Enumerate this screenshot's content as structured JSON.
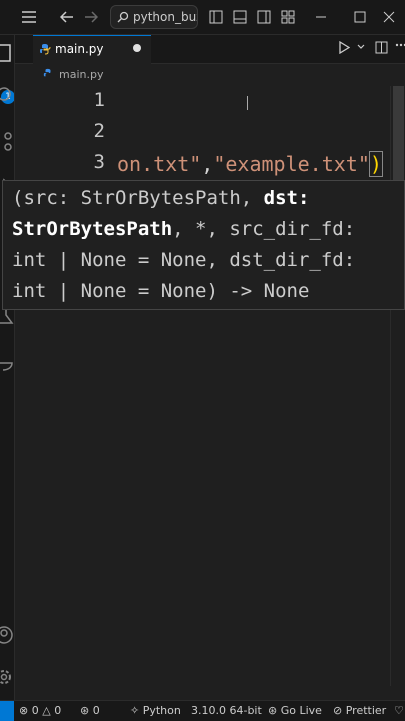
{
  "titlebar": {
    "search_text": "python_buzz",
    "icons": [
      "menu-icon",
      "back-arrow-icon",
      "forward-arrow-icon",
      "search-icon",
      "toggle-primary-sidebar-icon",
      "toggle-panel-icon",
      "toggle-secondary-sidebar-icon",
      "customize-layout-icon",
      "minimize-icon",
      "maximize-icon",
      "close-icon"
    ]
  },
  "activity_bar": {
    "badge": "1"
  },
  "tab": {
    "filename": "main.py",
    "modified": true
  },
  "breadcrumb": {
    "file": "main.py"
  },
  "editor": {
    "line_numbers": [
      "1",
      "2",
      "3"
    ],
    "line3_string1": "on.txt\"",
    "line3_comma": ",",
    "line3_string2": "\"example.txt\"",
    "line3_close": ")"
  },
  "hover": {
    "line1_a": "(src: StrOrBytesPath, ",
    "line1_b": "dst:",
    "line2_a": "StrOrBytesPath",
    "line2_b": ", *, src_dir_fd:",
    "line3": "int | None = None, dst_dir_fd:",
    "line4": "int | None = None) -> None"
  },
  "statusbar": {
    "errors": "0",
    "warnings": "0",
    "ports": "0",
    "language": "Python",
    "interpreter": "3.10.0 64-bit",
    "golive": "Go Live",
    "prettier": "Prettier"
  },
  "colors": {
    "accent": "#0078d4",
    "string": "#ce9178",
    "bracket": "#ffd700",
    "background": "#1f1f1f"
  }
}
